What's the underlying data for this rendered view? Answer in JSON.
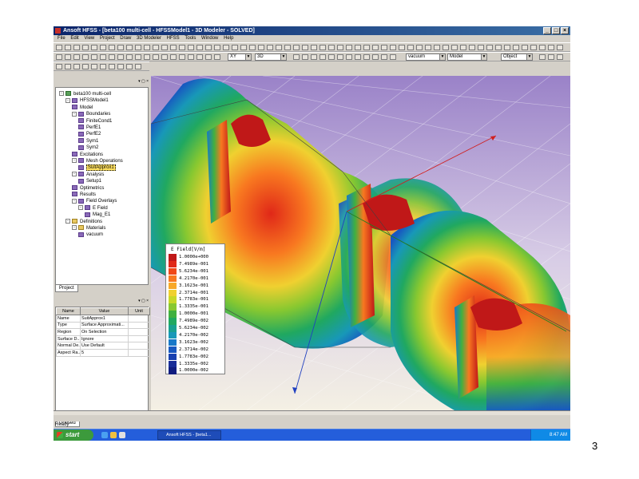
{
  "window": {
    "title": "Ansoft HFSS - [beta100 multi-cell - HFSSModel1 - 3D Modeler - SOLVED]",
    "minimize": "_",
    "maximize": "□",
    "close": "×"
  },
  "menu": [
    "File",
    "Edit",
    "View",
    "Project",
    "Draw",
    "3D Modeler",
    "HFSS",
    "Tools",
    "Window",
    "Help"
  ],
  "toolbar": {
    "plane": "XY",
    "dimension": "3D",
    "material": "vacuum",
    "mode": "Model",
    "select": "Object"
  },
  "project_tree": [
    {
      "label": "beta100 multi-cell",
      "level": 0,
      "icon": "project-icon",
      "expand": "-"
    },
    {
      "label": "HFSSModel1",
      "level": 1,
      "icon": "model-icon",
      "expand": "-"
    },
    {
      "label": "Model",
      "level": 2,
      "icon": "model-icon",
      "expand": ""
    },
    {
      "label": "Boundaries",
      "level": 2,
      "icon": "boundary-icon",
      "expand": "-"
    },
    {
      "label": "FiniteCond1",
      "level": 3,
      "icon": "boundary-icon",
      "expand": ""
    },
    {
      "label": "PerfE1",
      "level": 3,
      "icon": "boundary-icon",
      "expand": ""
    },
    {
      "label": "PerfE2",
      "level": 3,
      "icon": "boundary-icon",
      "expand": ""
    },
    {
      "label": "Sym1",
      "level": 3,
      "icon": "boundary-icon",
      "expand": ""
    },
    {
      "label": "Sym2",
      "level": 3,
      "icon": "boundary-icon",
      "expand": ""
    },
    {
      "label": "Excitations",
      "level": 2,
      "icon": "excitation-icon",
      "expand": ""
    },
    {
      "label": "Mesh Operations",
      "level": 2,
      "icon": "mesh-icon",
      "expand": "-"
    },
    {
      "label": "SuitApprox1",
      "level": 3,
      "icon": "mesh-icon",
      "expand": "",
      "selected": true
    },
    {
      "label": "Analysis",
      "level": 2,
      "icon": "analysis-icon",
      "expand": "-"
    },
    {
      "label": "Setup1",
      "level": 3,
      "icon": "setup-icon",
      "expand": ""
    },
    {
      "label": "Optimetrics",
      "level": 2,
      "icon": "optimetrics-icon",
      "expand": ""
    },
    {
      "label": "Results",
      "level": 2,
      "icon": "results-icon",
      "expand": ""
    },
    {
      "label": "Field Overlays",
      "level": 2,
      "icon": "overlay-icon",
      "expand": "-"
    },
    {
      "label": "E Field",
      "level": 3,
      "icon": "efield-icon",
      "expand": "-"
    },
    {
      "label": "Mag_E1",
      "level": 4,
      "icon": "plot-icon",
      "expand": ""
    },
    {
      "label": "Definitions",
      "level": 1,
      "icon": "folder-icon",
      "expand": "-"
    },
    {
      "label": "Materials",
      "level": 2,
      "icon": "folder-icon",
      "expand": "-"
    },
    {
      "label": "vacuum",
      "level": 3,
      "icon": "material-icon",
      "expand": ""
    }
  ],
  "project_tab": "Project",
  "properties": {
    "headers": [
      "Name",
      "Value",
      "Unit"
    ],
    "rows": [
      [
        "Name",
        "SuitApprox1",
        ""
      ],
      [
        "Type",
        "Surface Approximati...",
        ""
      ],
      [
        "Region",
        "On Selection",
        ""
      ],
      [
        "Surface D...",
        "Ignore",
        ""
      ],
      [
        "Normal De...",
        "Use Default",
        ""
      ],
      [
        "Aspect Ra...",
        "5",
        ""
      ]
    ],
    "tab": "Unused"
  },
  "legend": {
    "title": "E Field[V/m]",
    "entries": [
      {
        "value": "1.0000e+000",
        "color": "#c01818"
      },
      {
        "value": "7.4989e-001",
        "color": "#e02818"
      },
      {
        "value": "5.6234e-001",
        "color": "#f04818"
      },
      {
        "value": "4.2170e-001",
        "color": "#f87820"
      },
      {
        "value": "3.1623e-001",
        "color": "#f8a828"
      },
      {
        "value": "2.3714e-001",
        "color": "#f0d030"
      },
      {
        "value": "1.7783e-001",
        "color": "#c8d828"
      },
      {
        "value": "1.3335e-001",
        "color": "#88c830"
      },
      {
        "value": "1.0000e-001",
        "color": "#40b040"
      },
      {
        "value": "7.4989e-002",
        "color": "#20a860"
      },
      {
        "value": "5.6234e-002",
        "color": "#18a090"
      },
      {
        "value": "4.2170e-002",
        "color": "#1898b8"
      },
      {
        "value": "3.1623e-002",
        "color": "#1878c8"
      },
      {
        "value": "2.3714e-002",
        "color": "#1858c0"
      },
      {
        "value": "1.7783e-002",
        "color": "#1840b0"
      },
      {
        "value": "1.3335e-002",
        "color": "#182c98"
      },
      {
        "value": "1.0000e-002",
        "color": "#101c80"
      }
    ]
  },
  "status": "Ready",
  "taskbar": {
    "start": "start",
    "task": "Ansoft HFSS - [beta1...",
    "clock": "8:47 AM"
  },
  "slide_number": "3"
}
